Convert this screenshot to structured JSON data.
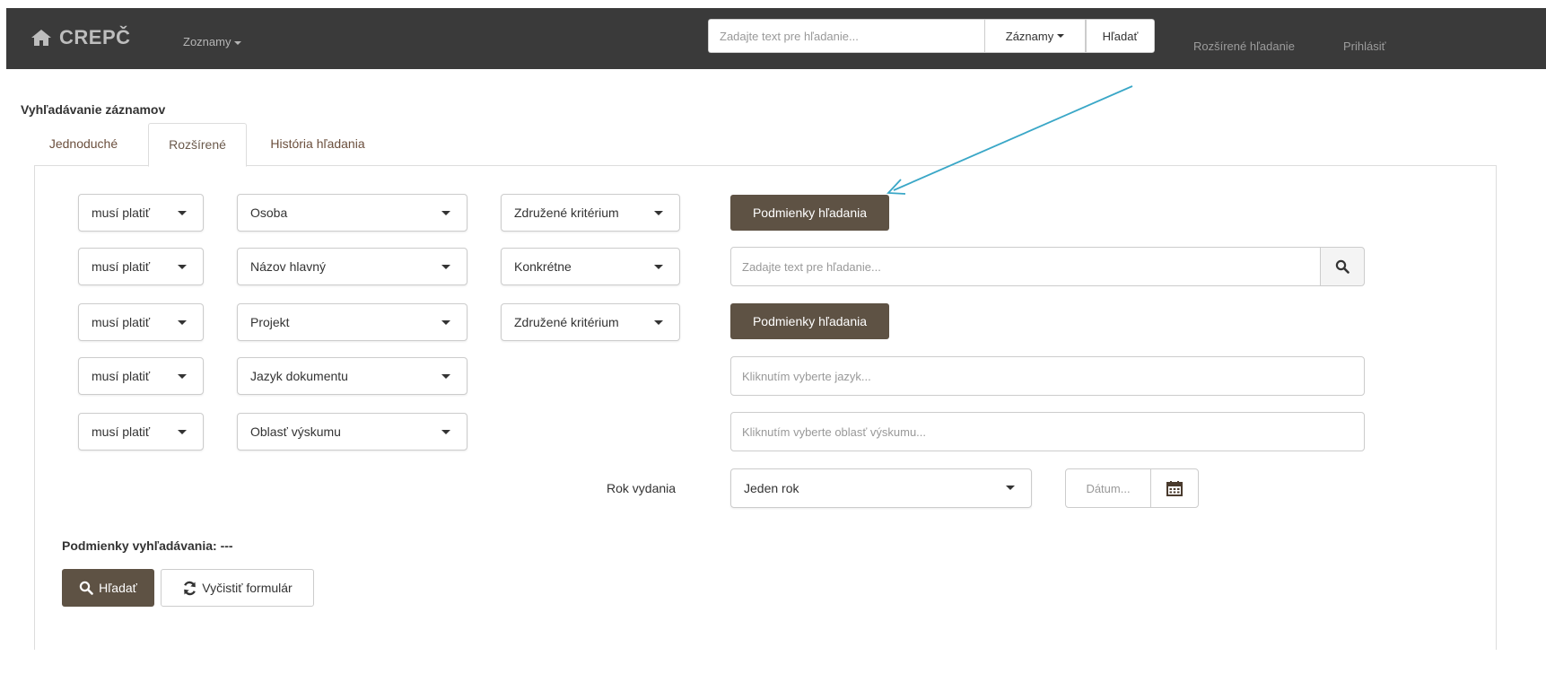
{
  "app": {
    "brand": "CREPČ",
    "nav_dropdown": "Zoznamy",
    "search_placeholder": "Zadajte text pre hľadanie...",
    "search_scope": "Záznamy",
    "search_button": "Hľadať",
    "link_advanced": "Rozšírené hľadanie",
    "link_login": "Prihlásiť"
  },
  "page": {
    "title": "Vyhľadávanie záznamov",
    "tabs": [
      "Jednoduché",
      "Rozšírené",
      "História hľadania"
    ],
    "active_tab": "Rozšírené"
  },
  "rows": [
    {
      "must": "musí platiť",
      "field": "Osoba",
      "mode": "Združené kritérium",
      "action": "Podmienky hľadania"
    },
    {
      "must": "musí platiť",
      "field": "Názov hlavný",
      "mode": "Konkrétne",
      "input_placeholder": "Zadajte text pre hľadanie..."
    },
    {
      "must": "musí platiť",
      "field": "Projekt",
      "mode": "Združené kritérium",
      "action": "Podmienky hľadania"
    },
    {
      "must": "musí platiť",
      "field": "Jazyk dokumentu",
      "input_placeholder": "Kliknutím vyberte jazyk..."
    },
    {
      "must": "musí platiť",
      "field": "Oblasť výskumu",
      "input_placeholder": "Kliknutím vyberte oblasť výskumu..."
    }
  ],
  "year": {
    "label": "Rok vydania",
    "mode": "Jeden rok",
    "date_placeholder": "Dátum..."
  },
  "summary": {
    "label": "Podmienky vyhľadávania: ---"
  },
  "actions": {
    "search": "Hľadať",
    "clear": "Vyčistiť formulár"
  },
  "colors": {
    "navbar": "#3a3a3a",
    "dark_button": "#5e5244",
    "tab_link": "#6b4f3d",
    "annotation_arrow": "#3aa7c7"
  }
}
